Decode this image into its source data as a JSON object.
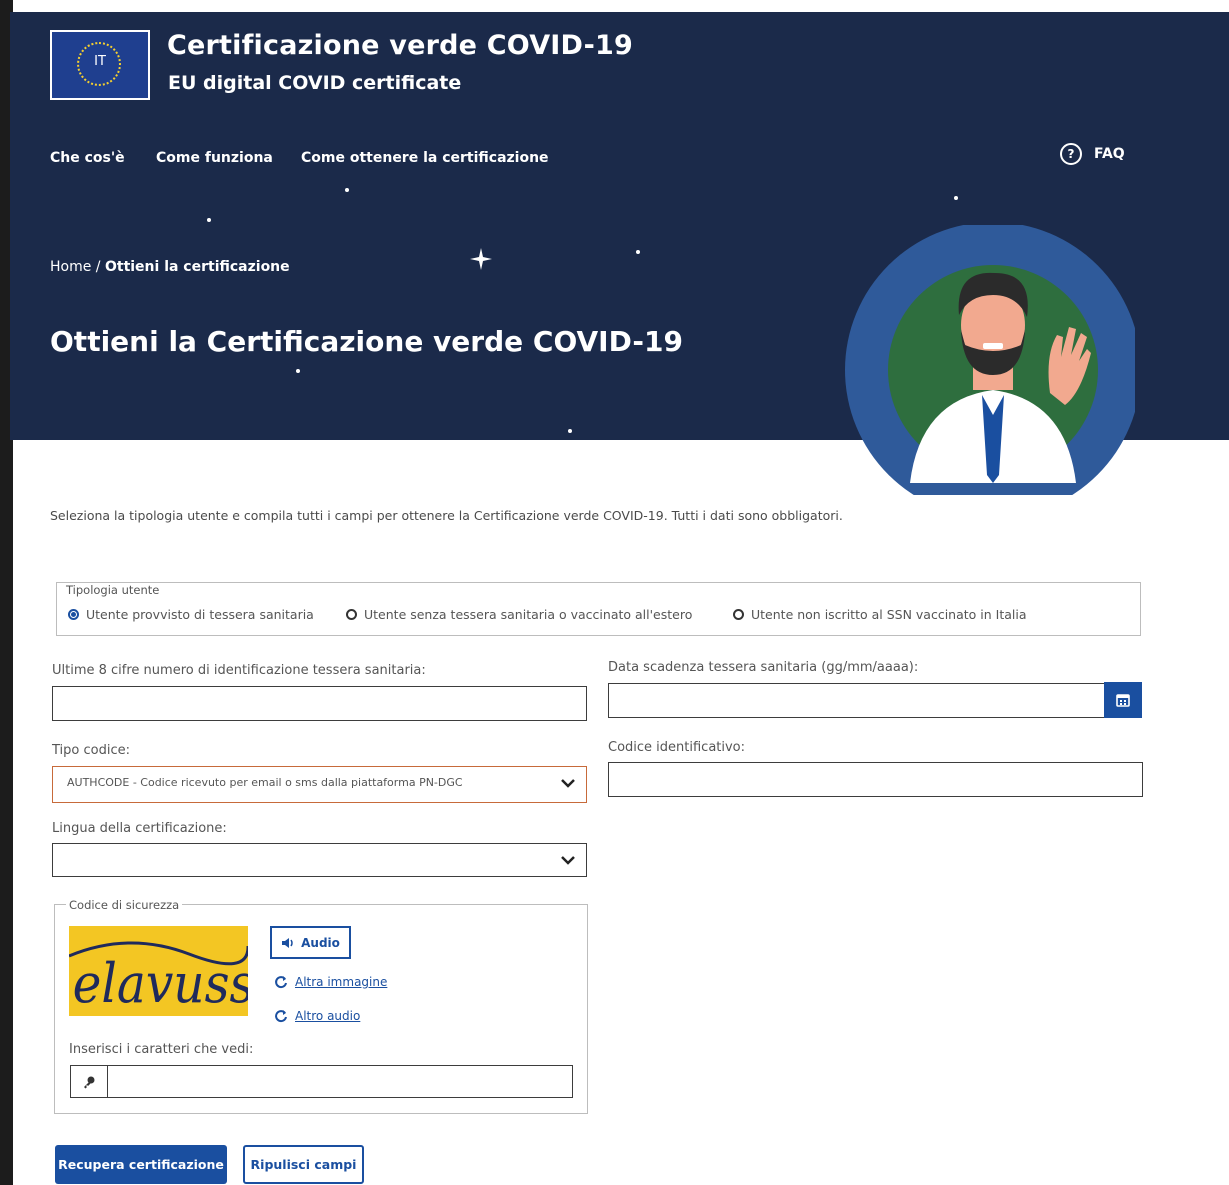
{
  "header": {
    "logo_label": "IT",
    "title": "Certificazione verde COVID-19",
    "subtitle": "EU digital COVID certificate",
    "nav": [
      "Che cos'è",
      "Come funziona",
      "Come ottenere la certificazione"
    ],
    "faq_label": "FAQ",
    "breadcrumb_home": "Home",
    "breadcrumb_sep": "/",
    "breadcrumb_current": "Ottieni la certificazione",
    "page_title": "Ottieni la Certificazione verde COVID-19"
  },
  "form": {
    "intro": "Seleziona la tipologia utente e compila tutti i campi per ottenere la Certificazione verde COVID-19. Tutti i dati sono obbligatori.",
    "user_type": {
      "legend": "Tipologia utente",
      "options": [
        "Utente provvisto di tessera sanitaria",
        "Utente senza tessera sanitaria o vaccinato all'estero",
        "Utente non iscritto al SSN vaccinato in Italia"
      ],
      "selected_index": 0
    },
    "card_digits_label": "Ultime 8 cifre numero di identificazione tessera sanitaria:",
    "card_digits_value": "",
    "expiry_label": "Data scadenza tessera sanitaria (gg/mm/aaaa):",
    "expiry_value": "",
    "code_type_label": "Tipo codice:",
    "code_type_value": "AUTHCODE - Codice ricevuto per email o sms dalla piattaforma PN-DGC",
    "id_code_label": "Codice identificativo:",
    "id_code_value": "",
    "language_label": "Lingua della certificazione:",
    "language_value": "",
    "captcha": {
      "legend": "Codice di sicurezza",
      "image_text": "elavusse",
      "audio_label": "Audio",
      "other_image_label": "Altra immagine",
      "other_audio_label": "Altro audio",
      "input_label": "Inserisci i caratteri che vedi:",
      "input_value": ""
    },
    "submit_label": "Recupera certificazione",
    "reset_label": "Ripulisci campi"
  },
  "colors": {
    "header_bg": "#1b2a4a",
    "primary": "#1a4fa0",
    "captcha_bg": "#f3c623"
  },
  "icons": [
    "eu-stars-icon",
    "help-circle-icon",
    "sparkle-icon",
    "calendar-icon",
    "chevron-down-icon",
    "speaker-icon",
    "refresh-icon",
    "key-icon"
  ]
}
